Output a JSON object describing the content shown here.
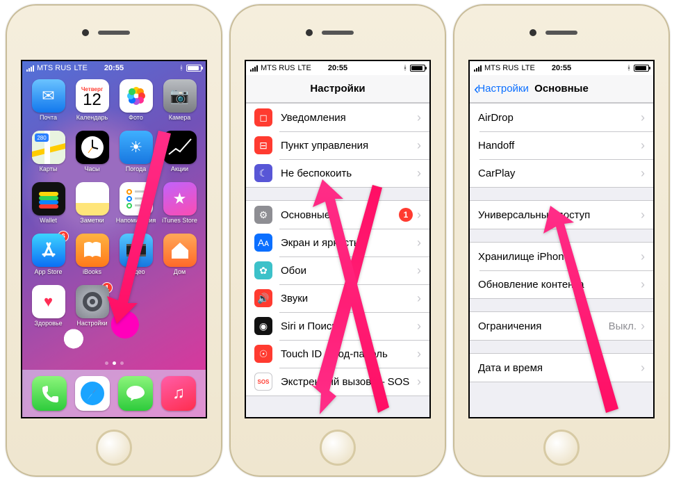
{
  "status": {
    "carrier": "MTS RUS",
    "net": "LTE",
    "time": "20:55",
    "bt": "✱"
  },
  "home": {
    "calendar": {
      "dow": "Четверг",
      "day": "12"
    },
    "apps": [
      {
        "id": "mail",
        "label": "Почта"
      },
      {
        "id": "calendar",
        "label": "Календарь"
      },
      {
        "id": "photos",
        "label": "Фото"
      },
      {
        "id": "camera",
        "label": "Камера"
      },
      {
        "id": "maps",
        "label": "Карты"
      },
      {
        "id": "clock",
        "label": "Часы"
      },
      {
        "id": "weather",
        "label": "Погода"
      },
      {
        "id": "stocks",
        "label": "Акции"
      },
      {
        "id": "wallet",
        "label": "Wallet"
      },
      {
        "id": "notes",
        "label": "Заметки"
      },
      {
        "id": "reminders",
        "label": "Напоминания"
      },
      {
        "id": "itunes",
        "label": "iTunes Store"
      },
      {
        "id": "appstore",
        "label": "App Store",
        "badge": "6"
      },
      {
        "id": "ibooks",
        "label": "iBooks"
      },
      {
        "id": "video",
        "label": "Видео"
      },
      {
        "id": "homekit",
        "label": "Дом"
      },
      {
        "id": "health",
        "label": "Здоровье"
      },
      {
        "id": "settings",
        "label": "Настройки",
        "badge": "1"
      }
    ]
  },
  "settings": {
    "title": "Настройки",
    "rows": {
      "notify": "Уведомления",
      "control": "Пункт управления",
      "dnd": "Не беспокоить",
      "general": "Основные",
      "general_badge": "1",
      "display": "Экран и яркость",
      "wallpaper": "Обои",
      "sounds": "Звуки",
      "siri": "Siri и Поиск",
      "touchid": "Touch ID и код-пароль",
      "sos": "Экстренный вызов — SOS"
    }
  },
  "general": {
    "back": "Настройки",
    "title": "Основные",
    "rows": {
      "airdrop": "AirDrop",
      "handoff": "Handoff",
      "carplay": "CarPlay",
      "accessibility": "Универсальный доступ",
      "storage": "Хранилище iPhone",
      "refresh": "Обновление контента",
      "restrictions": "Ограничения",
      "restrictions_value": "Выкл.",
      "datetime": "Дата и время"
    }
  }
}
